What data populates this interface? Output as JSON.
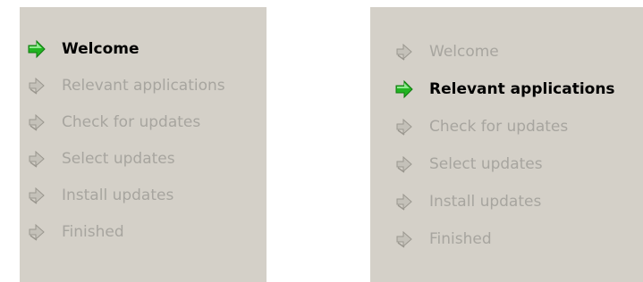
{
  "panels": [
    {
      "id": "left",
      "active_index": 0,
      "steps": [
        {
          "label": "Welcome",
          "icon": "arrow-active-icon"
        },
        {
          "label": "Relevant applications",
          "icon": "arrow-inactive-icon"
        },
        {
          "label": "Check for updates",
          "icon": "arrow-inactive-icon"
        },
        {
          "label": "Select updates",
          "icon": "arrow-inactive-icon"
        },
        {
          "label": "Install updates",
          "icon": "arrow-inactive-icon"
        },
        {
          "label": "Finished",
          "icon": "arrow-inactive-icon"
        }
      ]
    },
    {
      "id": "right",
      "active_index": 1,
      "steps": [
        {
          "label": "Welcome",
          "icon": "arrow-inactive-icon"
        },
        {
          "label": "Relevant applications",
          "icon": "arrow-active-icon"
        },
        {
          "label": "Check for updates",
          "icon": "arrow-inactive-icon"
        },
        {
          "label": "Select updates",
          "icon": "arrow-inactive-icon"
        },
        {
          "label": "Install updates",
          "icon": "arrow-inactive-icon"
        },
        {
          "label": "Finished",
          "icon": "arrow-inactive-icon"
        }
      ]
    }
  ],
  "colors": {
    "panel_background": "#d4d0c8",
    "active_text": "#000000",
    "inactive_text": "#a7a59f",
    "active_arrow": "#22b422",
    "inactive_arrow": "#a9a69e"
  }
}
